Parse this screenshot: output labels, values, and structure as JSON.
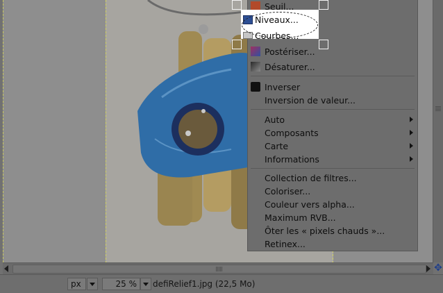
{
  "image": {
    "filename": "defiRelief1.jpg (22,5 Mo)"
  },
  "statusbar": {
    "unit": "px",
    "zoom": "25 %"
  },
  "menu": {
    "items_top": [
      {
        "label": "Seuil...",
        "icon": "threshold-icon"
      },
      {
        "label": "Niveaux...",
        "icon": "levels-icon"
      },
      {
        "label": "Courbes...",
        "icon": "curves-icon"
      },
      {
        "label": "Postériser...",
        "icon": "posterize-icon"
      },
      {
        "label": "Désaturer...",
        "icon": "desaturate-icon"
      }
    ],
    "items_invert": [
      {
        "label": "Inverser",
        "icon": "invert-icon"
      },
      {
        "label": "Inversion de valeur...",
        "icon": ""
      }
    ],
    "items_sub": [
      {
        "label": "Auto"
      },
      {
        "label": "Composants"
      },
      {
        "label": "Carte"
      },
      {
        "label": "Informations"
      }
    ],
    "items_filters": [
      {
        "label": "Collection de filtres..."
      },
      {
        "label": "Coloriser..."
      },
      {
        "label": "Couleur vers alpha..."
      },
      {
        "label": "Maximum RVB..."
      },
      {
        "label": "Ôter les « pixels chauds »..."
      },
      {
        "label": "Retinex..."
      }
    ]
  },
  "colors": {
    "highlight": "#ffffff",
    "dim_overlay": "#6d6d6d",
    "image_blue": "#3a7bb0",
    "wood": "#b59a5e"
  }
}
